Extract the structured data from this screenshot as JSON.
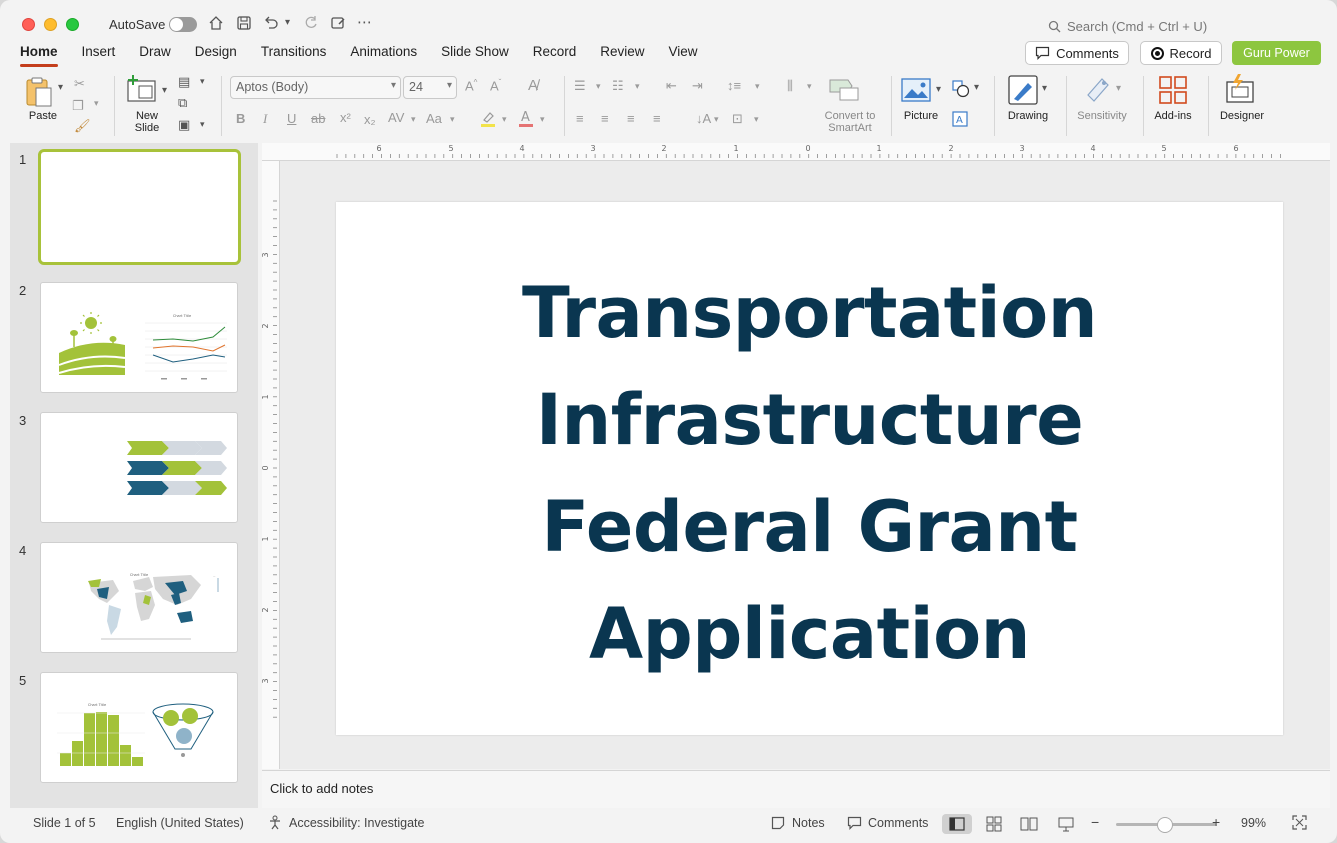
{
  "titlebar": {
    "autosave_label": "AutoSave",
    "search_placeholder": "Search (Cmd + Ctrl + U)"
  },
  "tabs": [
    {
      "label": "Home",
      "active": true
    },
    {
      "label": "Insert"
    },
    {
      "label": "Draw"
    },
    {
      "label": "Design"
    },
    {
      "label": "Transitions"
    },
    {
      "label": "Animations"
    },
    {
      "label": "Slide Show"
    },
    {
      "label": "Record"
    },
    {
      "label": "Review"
    },
    {
      "label": "View"
    }
  ],
  "header_buttons": {
    "comments": "Comments",
    "record": "Record",
    "guru": "Guru Power"
  },
  "ribbon": {
    "paste": "Paste",
    "new_slide_line1": "New",
    "new_slide_line2": "Slide",
    "font_name": "Aptos (Body)",
    "font_size": "24",
    "convert_line1": "Convert to",
    "convert_line2": "SmartArt",
    "picture": "Picture",
    "drawing": "Drawing",
    "sensitivity": "Sensitivity",
    "addins": "Add-ins",
    "designer": "Designer"
  },
  "colors": {
    "accent": "#c43e1c",
    "brand_green": "#8dc63f",
    "title_navy": "#0a3650",
    "thumb_green": "#a3c23a",
    "thumb_blue": "#1f5f7f"
  },
  "slides": [
    {
      "number": "1"
    },
    {
      "number": "2"
    },
    {
      "number": "3"
    },
    {
      "number": "4"
    },
    {
      "number": "5"
    }
  ],
  "slide": {
    "title_lines": [
      "Transportation",
      "Infrastructure",
      "Federal Grant",
      "Application"
    ]
  },
  "notes": {
    "placeholder": "Click to add notes"
  },
  "status": {
    "slide_of": "Slide 1 of 5",
    "language": "English (United States)",
    "accessibility": "Accessibility: Investigate",
    "notes": "Notes",
    "comments": "Comments",
    "zoom": "99%"
  }
}
